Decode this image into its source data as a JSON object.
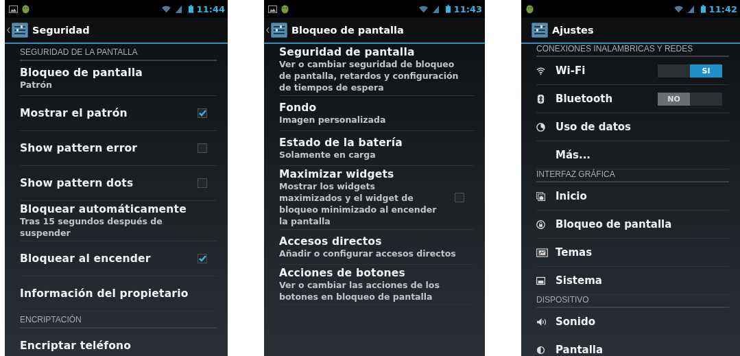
{
  "screens": [
    {
      "status_bar": {
        "notification_icons": [
          {
            "kind": "picture"
          },
          {
            "kind": "android"
          }
        ],
        "time": "11:44"
      },
      "action_bar": {
        "up": true,
        "title": "Seguridad"
      },
      "items": [
        {
          "kind": "section",
          "label": "SEGURIDAD DE LA PANTALLA"
        },
        {
          "kind": "setting",
          "title": "Bloqueo de pantalla",
          "summary": "Patrón"
        },
        {
          "kind": "setting",
          "title": "Mostrar el patrón",
          "checked": true
        },
        {
          "kind": "setting",
          "title": "Show pattern error",
          "checked": false
        },
        {
          "kind": "setting",
          "title": "Show pattern dots",
          "checked": false
        },
        {
          "kind": "setting",
          "title": "Bloquear automáticamente",
          "summary": "Tras 15 segundos después de suspender"
        },
        {
          "kind": "setting",
          "title": "Bloquear al encender",
          "checked": true
        },
        {
          "kind": "setting",
          "title": "Información del propietario"
        },
        {
          "kind": "section",
          "label": "ENCRIPTACIÓN"
        },
        {
          "kind": "setting",
          "title": "Encriptar teléfono"
        }
      ]
    },
    {
      "status_bar": {
        "notification_icons": [
          {
            "kind": "picture"
          },
          {
            "kind": "android"
          }
        ],
        "time": "11:43"
      },
      "action_bar": {
        "up": true,
        "title": "Bloqueo de pantalla"
      },
      "items": [
        {
          "kind": "setting",
          "title": "Seguridad de pantalla",
          "summary": "Ver o cambiar seguridad de bloqueo de pantalla, retardos y configuración de tiempos de espera"
        },
        {
          "kind": "setting",
          "title": "Fondo",
          "summary": "Imagen personalizada"
        },
        {
          "kind": "setting",
          "title": "Estado de la batería",
          "summary": "Solamente en carga"
        },
        {
          "kind": "setting",
          "title": "Maximizar widgets",
          "summary": "Mostrar los widgets maximizados y el widget de bloqueo minimizado al encender la pantalla",
          "checked": false
        },
        {
          "kind": "setting",
          "title": "Accesos directos",
          "summary": "Añadir o configurar accesos directos"
        },
        {
          "kind": "setting",
          "title": "Acciones de botones",
          "summary": "Ver o cambiar las acciones de los botones en bloqueo de pantalla"
        }
      ]
    },
    {
      "status_bar": {
        "notification_icons": [
          {
            "kind": "android"
          }
        ],
        "time": "11:42"
      },
      "action_bar": {
        "up": false,
        "title": "Ajustes"
      },
      "items": [
        {
          "kind": "section",
          "label": "CONEXIONES INALAMBRICAS Y REDES"
        },
        {
          "kind": "switch",
          "icon": {
            "kind": "wifi"
          },
          "title": "Wi-Fi",
          "on": true,
          "switch_label": "SI"
        },
        {
          "kind": "switch",
          "icon": {
            "kind": "bluetooth"
          },
          "title": "Bluetooth",
          "on": false,
          "switch_label": "NO"
        },
        {
          "kind": "entry",
          "icon": {
            "kind": "data"
          },
          "title": "Uso de datos"
        },
        {
          "kind": "entry",
          "title": "Más..."
        },
        {
          "kind": "section",
          "label": "INTERFAZ GRÁFICA"
        },
        {
          "kind": "entry",
          "icon": {
            "kind": "home"
          },
          "title": "Inicio"
        },
        {
          "kind": "entry",
          "icon": {
            "kind": "lock"
          },
          "title": "Bloqueo de pantalla"
        },
        {
          "kind": "entry",
          "icon": {
            "kind": "themes"
          },
          "title": "Temas"
        },
        {
          "kind": "entry",
          "icon": {
            "kind": "system"
          },
          "title": "Sistema"
        },
        {
          "kind": "section",
          "label": "DISPOSITIVO"
        },
        {
          "kind": "entry",
          "icon": {
            "kind": "sound"
          },
          "title": "Sonido"
        },
        {
          "kind": "entry",
          "icon": {
            "kind": "display"
          },
          "title": "Pantalla"
        }
      ]
    }
  ]
}
